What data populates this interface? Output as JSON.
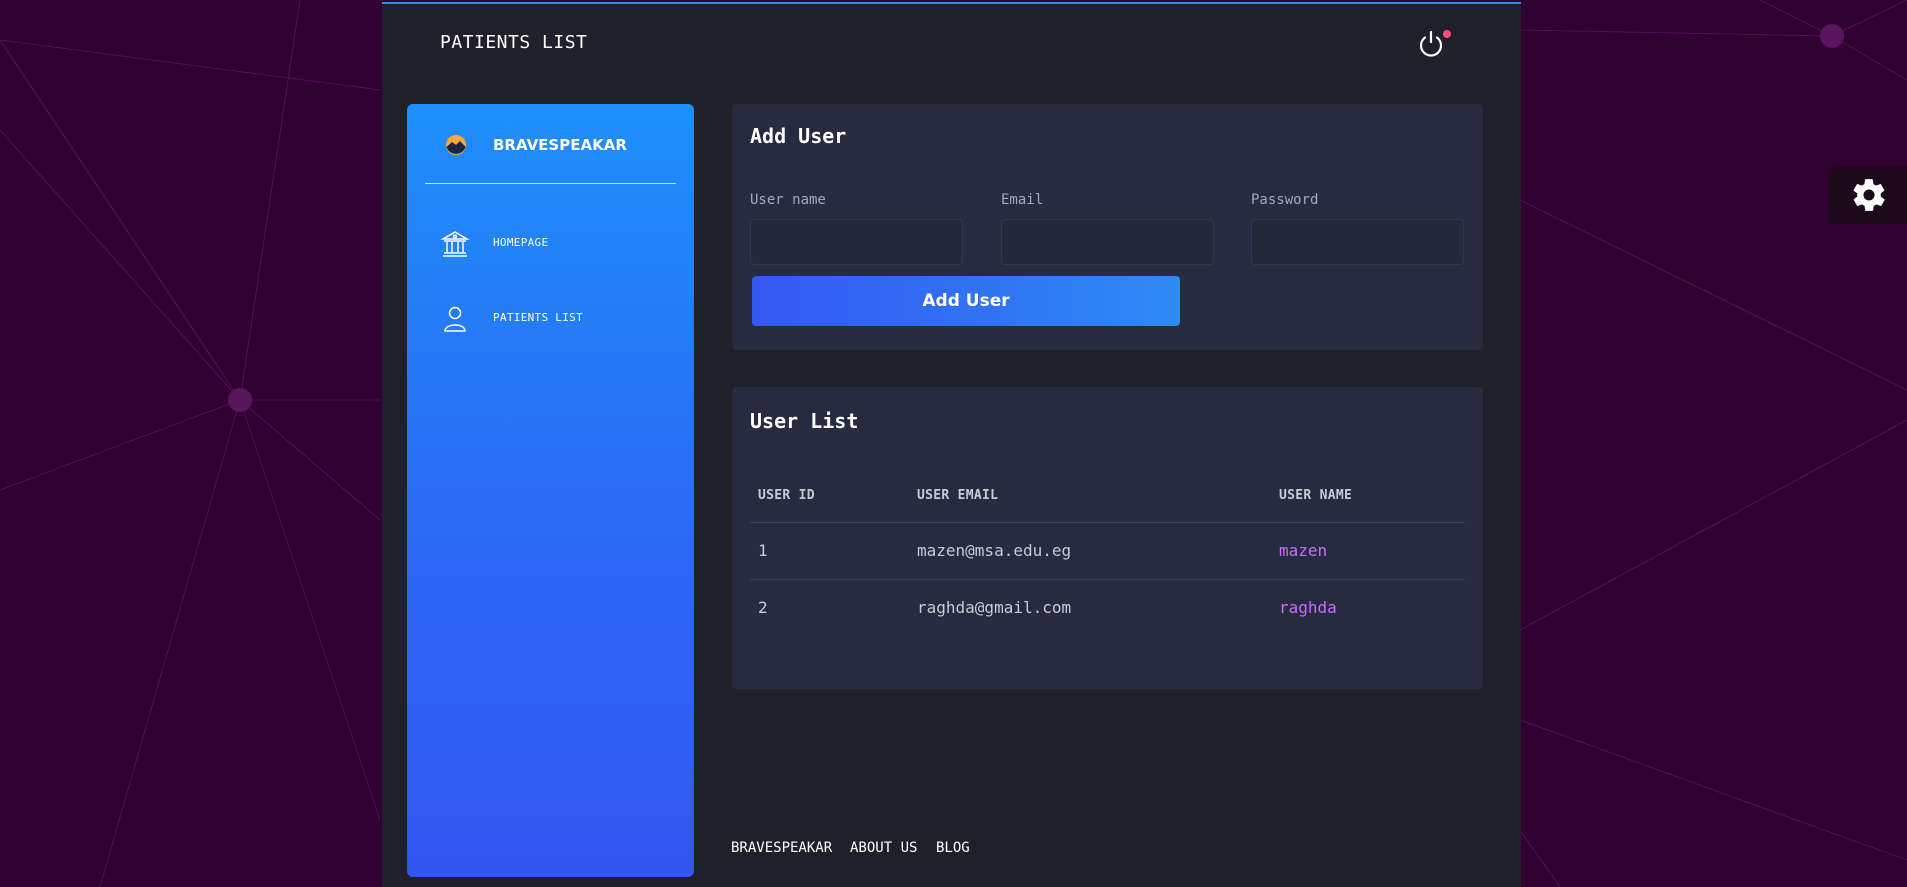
{
  "header": {
    "title": "PATIENTS LIST",
    "power_icon": "power-icon"
  },
  "sidebar": {
    "brand": "BRAVESPEAKAR",
    "items": [
      {
        "label": "HOMEPAGE",
        "icon": "bank-icon"
      },
      {
        "label": "PATIENTS LIST",
        "icon": "user-icon"
      }
    ]
  },
  "add_user": {
    "title": "Add User",
    "fields": [
      {
        "label": "User name",
        "value": ""
      },
      {
        "label": "Email",
        "value": ""
      },
      {
        "label": "Password",
        "value": ""
      }
    ],
    "button": "Add User"
  },
  "user_list": {
    "title": "User List",
    "columns": [
      "USER ID",
      "USER EMAIL",
      "USER NAME"
    ],
    "rows": [
      {
        "id": "1",
        "email": "mazen@msa.edu.eg",
        "name": "mazen"
      },
      {
        "id": "2",
        "email": "raghda@gmail.com",
        "name": "raghda"
      }
    ]
  },
  "footer": {
    "links": [
      "BRAVESPEAKAR",
      "ABOUT US",
      "BLOG"
    ]
  },
  "settings": {
    "icon": "gear-icon"
  },
  "colors": {
    "accent": "#2f8fe6",
    "name_link": "#c96bff",
    "background": "#300030",
    "panel": "#1f2029"
  }
}
